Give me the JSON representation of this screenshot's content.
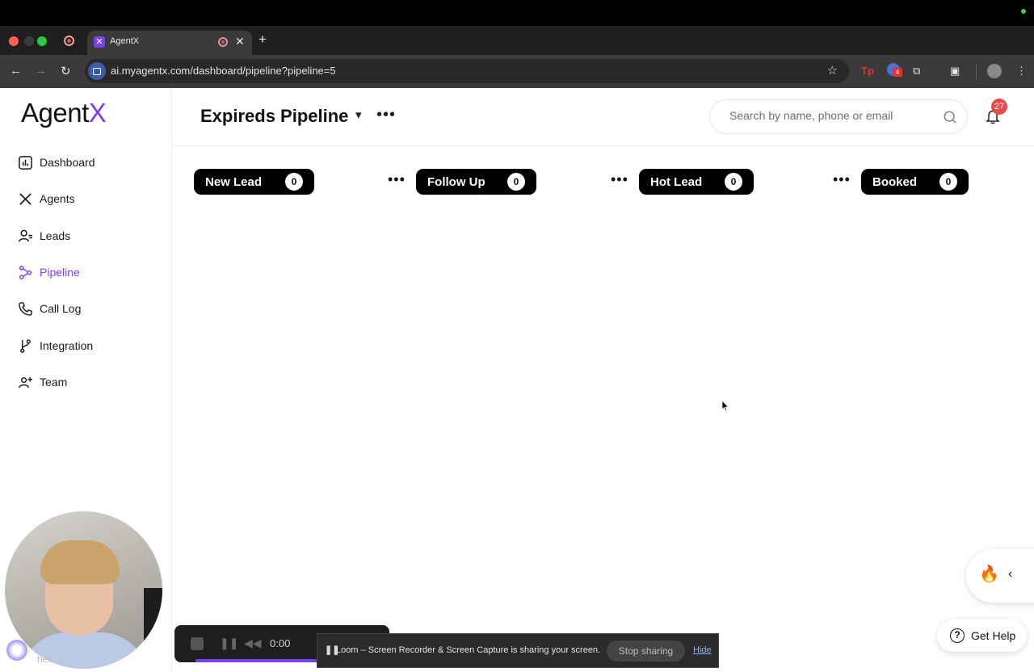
{
  "browser": {
    "tab_title": "AgentX",
    "url": "ai.myagentx.com/dashboard/pipeline?pipeline=5",
    "extension_badge": "4"
  },
  "sidebar": {
    "logo_text": "Agent",
    "logo_accent": "X",
    "items": [
      {
        "label": "Dashboard",
        "icon": "dashboard-icon",
        "active": false
      },
      {
        "label": "Agents",
        "icon": "agents-icon",
        "active": false
      },
      {
        "label": "Leads",
        "icon": "leads-icon",
        "active": false
      },
      {
        "label": "Pipeline",
        "icon": "pipeline-icon",
        "active": true
      },
      {
        "label": "Call Log",
        "icon": "phone-icon",
        "active": false
      },
      {
        "label": "Integration",
        "icon": "branch-icon",
        "active": false
      },
      {
        "label": "Team",
        "icon": "team-icon",
        "active": false
      }
    ]
  },
  "header": {
    "title": "Expireds Pipeline",
    "search_placeholder": "Search by name, phone or email",
    "notification_count": "27"
  },
  "stages": [
    {
      "name": "New Lead",
      "count": "0"
    },
    {
      "name": "Follow Up",
      "count": "0"
    },
    {
      "name": "Hot Lead",
      "count": "0"
    },
    {
      "name": "Booked",
      "count": "0"
    }
  ],
  "help": {
    "label": "Get Help"
  },
  "webcam_caption": "hell",
  "loom": {
    "timer": "0:00",
    "share_message": "Loom – Screen Recorder & Screen Capture is sharing your screen.",
    "stop_label": "Stop sharing",
    "hide_label": "Hide"
  },
  "colors": {
    "accent": "#7b3ff2",
    "badge": "#e94c4c",
    "stage_bg": "#000000"
  }
}
